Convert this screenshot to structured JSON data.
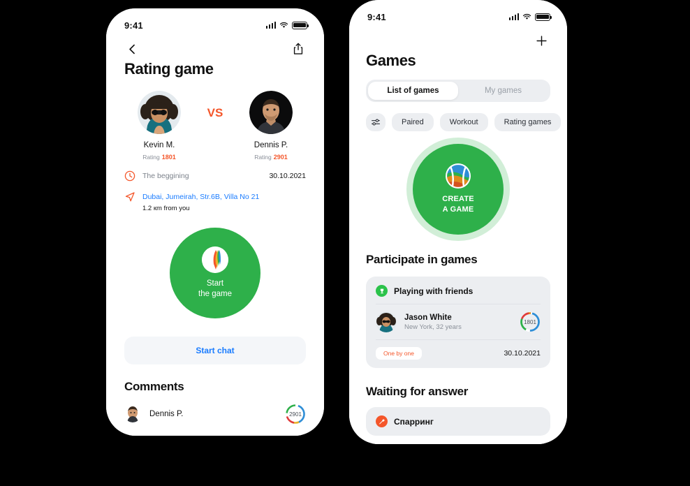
{
  "background_color": "#000000",
  "colors": {
    "green": "#2eb04a",
    "green_light": "#2bc24a",
    "orange": "#f4562a",
    "blue": "#1a7cff",
    "grey_bg": "#eceef1",
    "text_dark": "#111111",
    "text_muted": "#8a9099"
  },
  "status_bar": {
    "time": "9:41",
    "signal_icon": "signal-bars-icon",
    "wifi_icon": "wifi-icon",
    "battery_icon": "battery-full-icon"
  },
  "left_phone": {
    "nav": {
      "back_icon": "chevron-left-icon",
      "share_icon": "share-upload-icon"
    },
    "title": "Rating game",
    "match": {
      "vs_label": "VS",
      "players": [
        {
          "name": "Kevin M.",
          "rating_label": "Rating",
          "rating_value": "1801",
          "avatar_icon": "avatar-kevin"
        },
        {
          "name": "Dennis P.",
          "rating_label": "Rating",
          "rating_value": "2901",
          "avatar_icon": "avatar-dennis"
        }
      ]
    },
    "info": {
      "time_icon": "clock-icon",
      "time_label": "The beggining",
      "date": "30.10.2021",
      "location_icon": "navigation-arrow-icon",
      "address": "Dubai, Jumeirah, Str.6B, Villa No 21",
      "distance": "1.2 кm from you"
    },
    "start_button": {
      "line1": "Start",
      "line2": "the game",
      "logo_icon": "app-ball-logo-icon"
    },
    "chat_button": "Start chat",
    "comments": {
      "title": "Comments",
      "items": [
        {
          "author": "Dennis P.",
          "rating": "2901",
          "avatar_icon": "avatar-dennis"
        }
      ]
    }
  },
  "right_phone": {
    "nav": {
      "add_icon": "plus-icon"
    },
    "title": "Games",
    "segmented": {
      "options": [
        {
          "label": "List of games",
          "active": true
        },
        {
          "label": "My games",
          "active": false
        }
      ]
    },
    "filters": {
      "settings_icon": "sliders-filter-icon",
      "chips": [
        "Paired",
        "Workout",
        "Rating games"
      ]
    },
    "create_button": {
      "line1": "CREATE",
      "line2": "A GAME",
      "logo_icon": "app-ball-logo-icon"
    },
    "participate": {
      "title": "Participate in games",
      "card": {
        "badge_icon": "trophy-icon",
        "header": "Playing with friends",
        "person": {
          "name": "Jason White",
          "subtitle": "New York, 32 years",
          "rating": "1801",
          "avatar_icon": "avatar-jason"
        },
        "tag": "One by one",
        "date": "30.10.2021"
      }
    },
    "waiting": {
      "title": "Waiting for answer",
      "card": {
        "badge_icon": "sparring-icon",
        "header": "Спарринг"
      }
    }
  }
}
